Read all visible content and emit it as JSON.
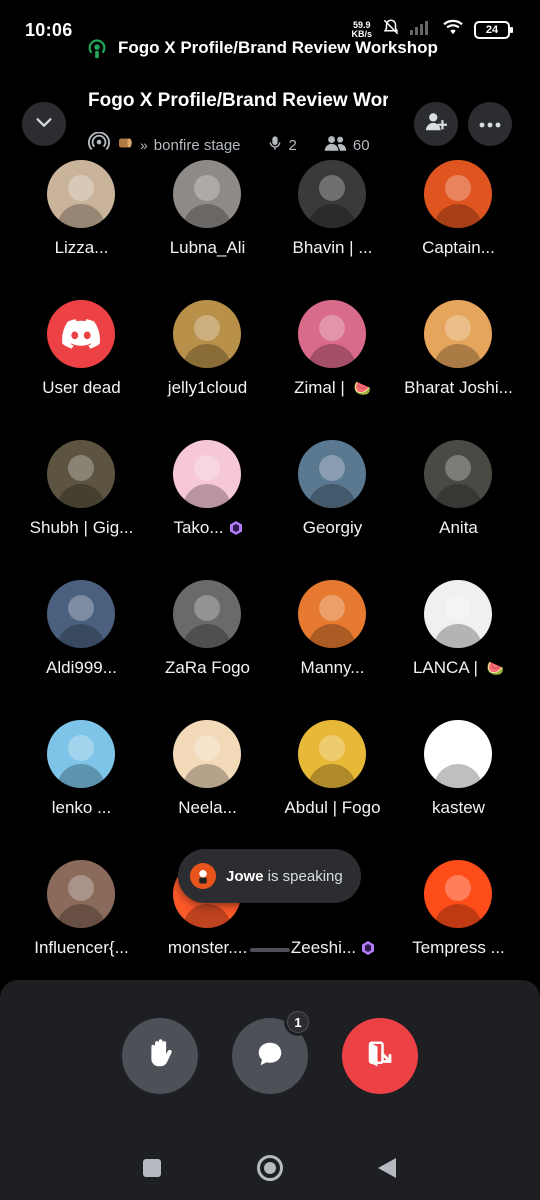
{
  "status_bar": {
    "time": "10:06",
    "net_speed_value": "59.9",
    "net_speed_unit": "KB/s",
    "battery": "24",
    "stage_notification": "Fogo X Profile/Brand Review Workshop"
  },
  "header": {
    "title": "Fogo X Profile/Brand Review Workshop",
    "channel": "bonfire stage",
    "speakers_count": "2",
    "listeners_count": "60"
  },
  "participants": [
    {
      "name": "Lizza...",
      "color": "#c9b39a"
    },
    {
      "name": "Lubna_Ali",
      "color": "#8f8a86"
    },
    {
      "name": "Bhavin | ...",
      "color": "#3a3a3a"
    },
    {
      "name": "Captain...",
      "color": "#e0551f"
    },
    {
      "name": "User dead",
      "color": "#ed4245"
    },
    {
      "name": "jelly1cloud",
      "color": "#b8904a"
    },
    {
      "name": "Zimal | ",
      "color": "#d86a8a",
      "emoji": "🍉"
    },
    {
      "name": "Bharat Joshi...",
      "color": "#e5a55c"
    },
    {
      "name": "Shubh | Gig...",
      "color": "#5c5440"
    },
    {
      "name": "Tako...",
      "color": "#f6c7d4",
      "gem": true
    },
    {
      "name": "Georgiy",
      "color": "#5a7890"
    },
    {
      "name": "Anita",
      "color": "#4a4a44"
    },
    {
      "name": "Aldi999...",
      "color": "#4b607e"
    },
    {
      "name": "ZaRa Fogo",
      "color": "#6a6a6a"
    },
    {
      "name": "Manny...",
      "color": "#e67a30"
    },
    {
      "name": "LANCA | ",
      "color": "#f0f0f0",
      "emoji": "🍉"
    },
    {
      "name": "lenko ...",
      "color": "#7ec4e8"
    },
    {
      "name": "Neela...",
      "color": "#f2d9b8"
    },
    {
      "name": "Abdul | Fogo",
      "color": "#e8b838"
    },
    {
      "name": "kastew",
      "color": "#ffffff"
    },
    {
      "name": "Influencer{...",
      "color": "#8a6a5a"
    },
    {
      "name": "monster....",
      "color": "#ff5a2a"
    },
    {
      "name": "Zeeshi...",
      "color": "#000000",
      "gem": true
    },
    {
      "name": "Tempress ...",
      "color": "#ff4d1a"
    }
  ],
  "speaking_toast": {
    "speaker": "Jowe",
    "suffix": " is speaking"
  },
  "actions": {
    "chat_badge": "1"
  },
  "icons": {
    "collapse": "chevron-down-icon",
    "invite": "add-user-icon",
    "more": "more-dots-icon",
    "stage": "stage-broadcast-icon",
    "mic": "microphone-icon",
    "listeners": "people-icon",
    "hand": "raise-hand-icon",
    "chat": "chat-bubble-icon",
    "leave": "leave-stage-icon"
  },
  "colors": {
    "leave_red": "#ed4245",
    "stage_green": "#23a55a",
    "gem_purple": "#b07cf7"
  }
}
